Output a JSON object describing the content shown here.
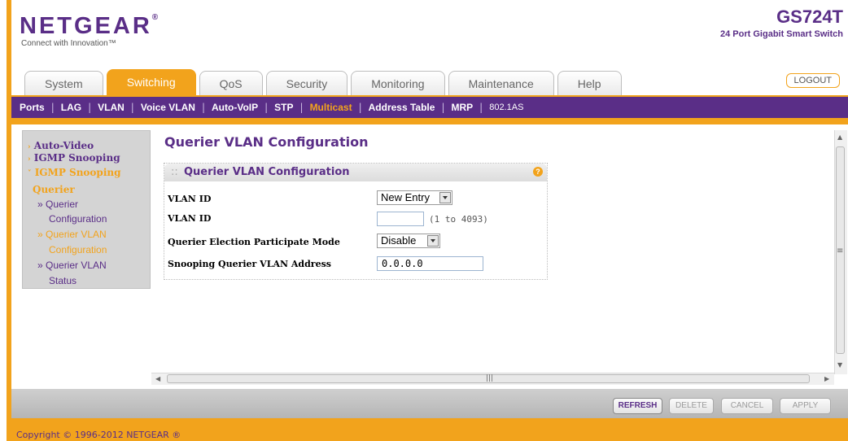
{
  "header": {
    "brand": "NETGEAR",
    "brand_mark": "®",
    "tagline": "Connect with Innovation™",
    "model": "GS724T",
    "model_desc": "24 Port Gigabit Smart Switch",
    "logout_label": "LOGOUT"
  },
  "tabs": [
    "System",
    "Switching",
    "QoS",
    "Security",
    "Monitoring",
    "Maintenance",
    "Help"
  ],
  "active_tab": "Switching",
  "subnav": [
    "Ports",
    "LAG",
    "VLAN",
    "Voice VLAN",
    "Auto-VoIP",
    "STP",
    "Multicast",
    "Address Table",
    "MRP",
    "802.1AS"
  ],
  "active_subnav": "Multicast",
  "sidebar": {
    "auto_video": "Auto-Video",
    "igmp_snooping": "IGMP Snooping",
    "igmp_querier_1": "IGMP Snooping",
    "igmp_querier_2": "Querier",
    "querier_config_1": "» Querier",
    "querier_config_2": "Configuration",
    "querier_vlan_config_1": "» Querier VLAN",
    "querier_vlan_config_2": "Configuration",
    "querier_vlan_status_1": "» Querier VLAN",
    "querier_vlan_status_2": "Status"
  },
  "page_title": "Querier VLAN Configuration",
  "panel": {
    "title": "Querier VLAN Configuration",
    "help": "?"
  },
  "form": {
    "vlan_id_select_label": "VLAN ID",
    "vlan_id_select_value": "New Entry",
    "vlan_id_input_label": "VLAN ID",
    "vlan_id_input_value": "",
    "vlan_id_hint": "(1 to 4093)",
    "election_mode_label": "Querier Election Participate Mode",
    "election_mode_value": "Disable",
    "snooping_address_label": "Snooping Querier VLAN Address",
    "snooping_address_value": "0.0.0.0"
  },
  "buttons": {
    "refresh": "REFRESH",
    "delete": "DELETE",
    "cancel": "CANCEL",
    "apply": "APPLY"
  },
  "footer": {
    "copyright": "Copyright © 1996-2012 NETGEAR ®"
  },
  "colors": {
    "brand_purple": "#5a2e87",
    "accent_orange": "#f2a31c"
  }
}
